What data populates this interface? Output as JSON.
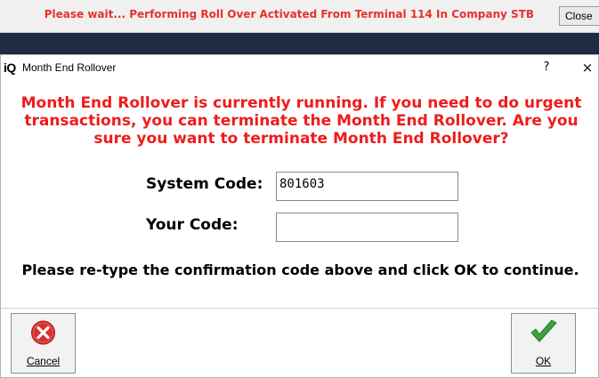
{
  "topbar": {
    "message": "Please wait... Performing Roll Over Activated From Terminal 114 In Company STB",
    "close_label": "Close"
  },
  "dialog": {
    "app_icon_text": "iQ",
    "title": "Month End Rollover",
    "help_label": "?",
    "close_label": "×",
    "warning": "Month End Rollover is currently running. If you need to do urgent transactions, you can terminate the Month End Rollover. Are you sure you want to terminate Month End Rollover?",
    "system_code_label": "System Code:",
    "system_code_value": "801603",
    "your_code_label": "Your Code:",
    "your_code_value": "",
    "instruction": "Please re-type the confirmation code above and click OK to continue."
  },
  "buttons": {
    "cancel": {
      "label": "Cancel",
      "icon": "cancel-circle-icon"
    },
    "ok": {
      "label": "OK",
      "icon": "checkmark-icon"
    }
  },
  "colors": {
    "warning_red": "#ee1c1c",
    "topbar_red": "#e8312b",
    "dark_band": "#1f2a44",
    "ok_green": "#3aa53a",
    "cancel_red": "#d9302c"
  }
}
